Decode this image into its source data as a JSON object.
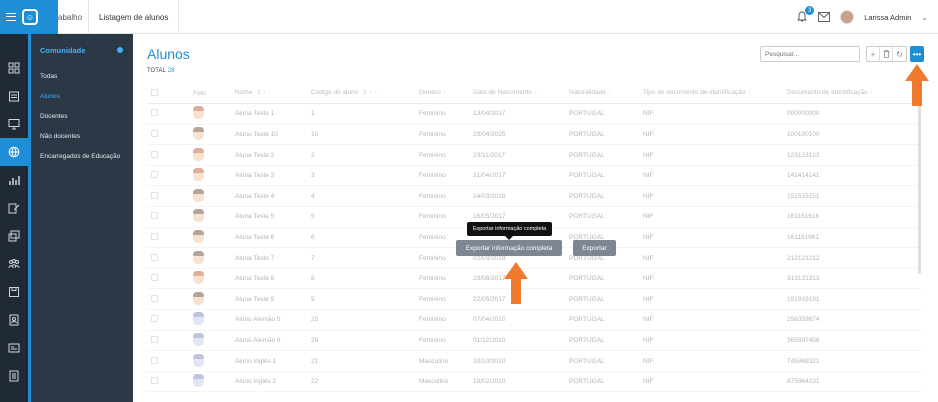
{
  "topbar": {
    "prev_tab": "abalho",
    "active_tab": "Listagem de alunos",
    "notifications": "3",
    "user_name": "Larissa Admin"
  },
  "submenu": {
    "title": "Comunidade",
    "items": [
      "Todas",
      "Alunos",
      "Docentes",
      "Não docentes",
      "Encarregados de Educação"
    ]
  },
  "main": {
    "title": "Alunos",
    "total_label": "TOTAL",
    "total_value": "28",
    "search_placeholder": "Pesquisar...",
    "more_label": "•••"
  },
  "table": {
    "headers": [
      "Foto",
      "Nome",
      "Código do aluno",
      "Genero",
      "Data de Nascimento",
      "Naturalidade",
      "Tipo de documento de identificação",
      "Documento de Identificação"
    ],
    "sort_name": "1 ↑",
    "sort_code": "2 ↑",
    "rows": [
      [
        "Aluna Teste 1",
        "1",
        "Feminino",
        "13/04/2017",
        "PORTUGAL",
        "NIF",
        "000000000"
      ],
      [
        "Aluno Teste 10",
        "10",
        "Feminino",
        "29/04/2025",
        "PORTUGAL",
        "NIF",
        "100100100"
      ],
      [
        "Aluna Teste 2",
        "2",
        "Feminino",
        "23/11/2017",
        "PORTUGAL",
        "NIF",
        "123123123"
      ],
      [
        "Aluna Teste 3",
        "3",
        "Feminino",
        "21/04/2017",
        "PORTUGAL",
        "NIF",
        "141414141"
      ],
      [
        "Aluna Teste 4",
        "4",
        "Feminino",
        "14/03/2018",
        "PORTUGAL",
        "NIF",
        "151515151"
      ],
      [
        "Aluna Teste 5",
        "5",
        "Feminino",
        "16/05/2017",
        "PORTUGAL",
        "NIF",
        "161161616"
      ],
      [
        "Aluna Teste 6",
        "6",
        "Feminino",
        "",
        "PORTUGAL",
        "NIF",
        "161161661"
      ],
      [
        "Aluna Teste 7",
        "7",
        "Feminino",
        "02/03/2018",
        "PORTUGAL",
        "NIF",
        "212121212"
      ],
      [
        "Aluna Teste 8",
        "8",
        "Feminino",
        "23/06/2017",
        "PORTUGAL",
        "NIF",
        "313131313"
      ],
      [
        "Aluna Teste 9",
        "9",
        "Feminino",
        "22/05/2017",
        "PORTUGAL",
        "NIF",
        "191919191"
      ],
      [
        "Aluno Alemão 5",
        "25",
        "Feminino",
        "07/04/2010",
        "PORTUGAL",
        "NIF",
        "256359874"
      ],
      [
        "Aluno Alemão 6",
        "26",
        "Feminino",
        "01/12/2010",
        "PORTUGAL",
        "NIF",
        "365897456"
      ],
      [
        "Aluno Inglês 1",
        "21",
        "Masculino",
        "20/10/2010",
        "PORTUGAL",
        "NIF",
        "745869321"
      ],
      [
        "Aluno Inglês 2",
        "22",
        "Masculino",
        "18/02/2010",
        "PORTUGAL",
        "NIF",
        "875964231"
      ]
    ],
    "photo_types": [
      "f",
      "m",
      "f",
      "f",
      "m",
      "m",
      "m",
      "m",
      "f",
      "m",
      "b",
      "b",
      "b",
      "b"
    ]
  },
  "overlay": {
    "tooltip": "Exportar informação completa",
    "export_full": "Exportar informação completa",
    "export": "Exportar"
  },
  "colors": {
    "accent": "#1e8fd6",
    "arrow": "#f07b2e",
    "sidebar": "#1f2a36"
  }
}
